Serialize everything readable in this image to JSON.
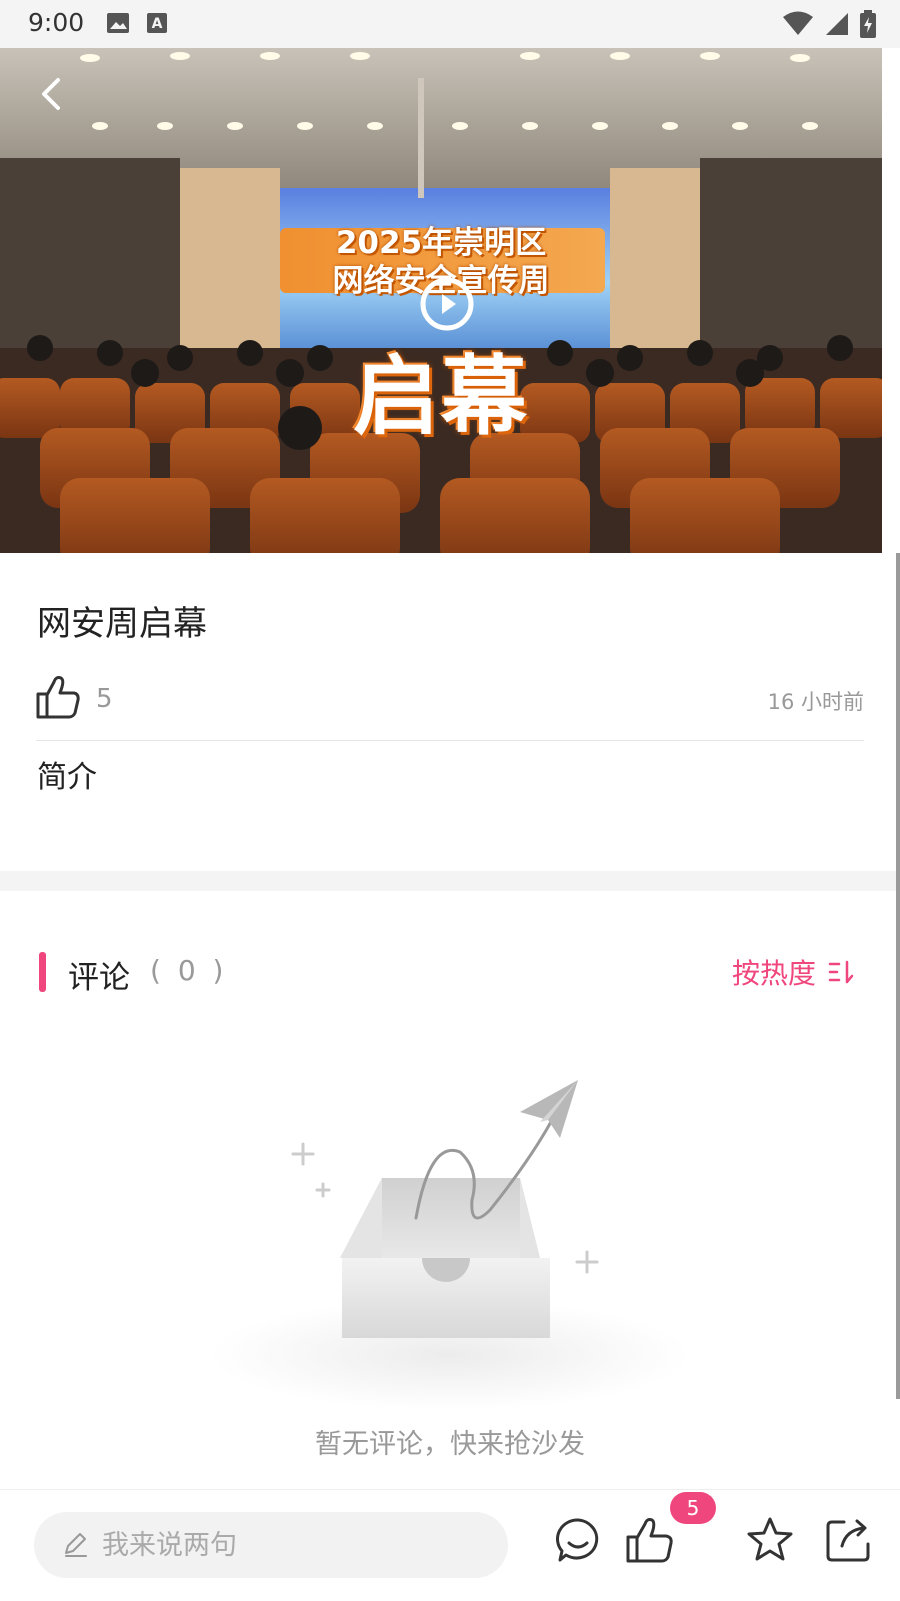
{
  "status_bar": {
    "time": "9:00",
    "icons": [
      "image-icon",
      "text-a-icon",
      "wifi-icon",
      "signal-icon",
      "battery-icon"
    ]
  },
  "video": {
    "screen_line1": "2025年崇明区",
    "screen_line2": "网络安全宣传周",
    "screen_title": "启幕",
    "icons": [
      "back-arrow-icon",
      "play-icon"
    ]
  },
  "post": {
    "title": "网安周启幕",
    "like_count": "5",
    "timestamp": "16 小时前",
    "intro_label": "简介"
  },
  "comments": {
    "label": "评论",
    "count": "( 0 )",
    "sort_label": "按热度",
    "empty_text": "暂无评论，快来抢沙发"
  },
  "bottom_bar": {
    "input_placeholder": "我来说两句",
    "like_badge": "5",
    "icons": [
      "pen-icon",
      "comment-icon",
      "thumb-up-icon",
      "star-icon",
      "share-icon"
    ]
  },
  "colors": {
    "accent": "#f0467e",
    "muted_text": "#999999",
    "separator": "#f4f4f4"
  }
}
